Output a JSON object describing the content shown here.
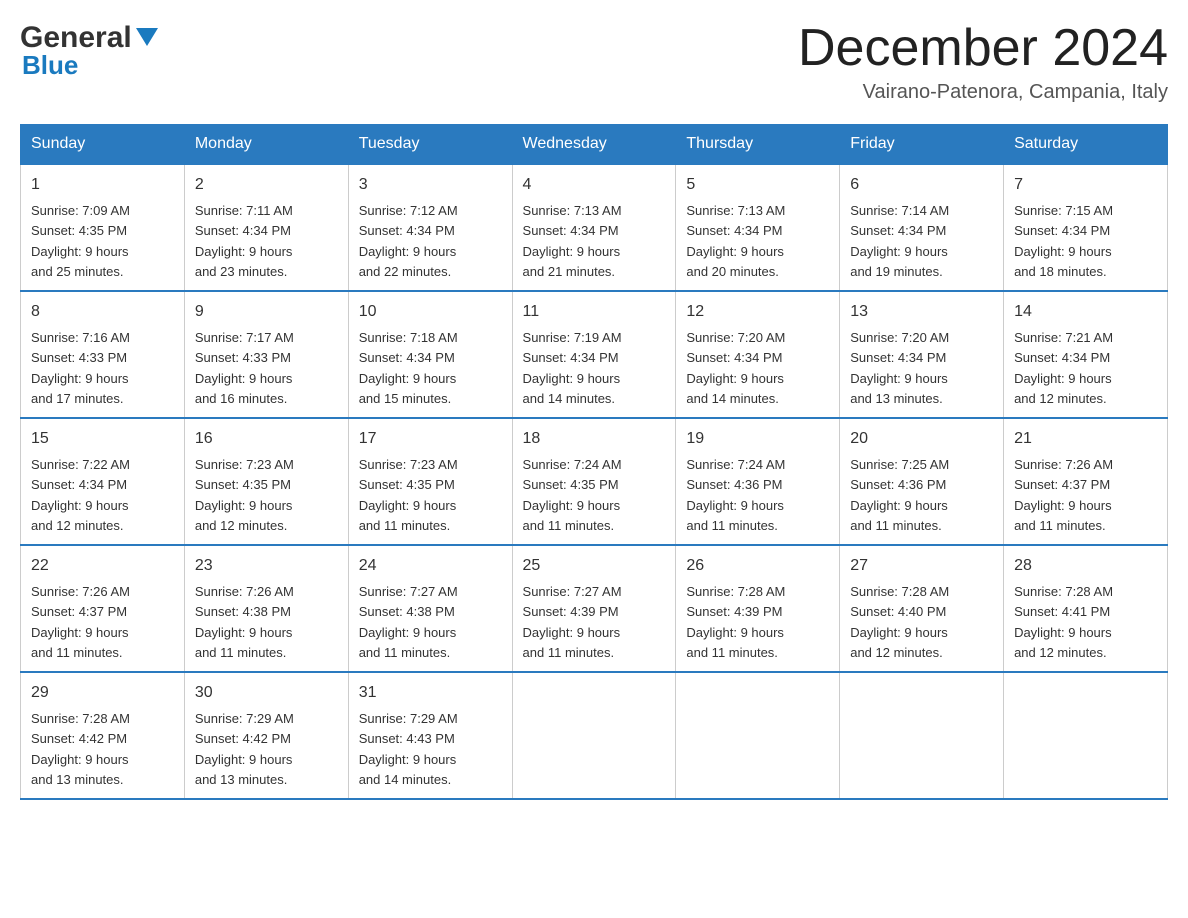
{
  "header": {
    "logo_general": "General",
    "logo_blue": "Blue",
    "month_title": "December 2024",
    "location": "Vairano-Patenora, Campania, Italy"
  },
  "days_of_week": [
    "Sunday",
    "Monday",
    "Tuesday",
    "Wednesday",
    "Thursday",
    "Friday",
    "Saturday"
  ],
  "weeks": [
    [
      {
        "day": "1",
        "sunrise": "7:09 AM",
        "sunset": "4:35 PM",
        "daylight": "9 hours and 25 minutes."
      },
      {
        "day": "2",
        "sunrise": "7:11 AM",
        "sunset": "4:34 PM",
        "daylight": "9 hours and 23 minutes."
      },
      {
        "day": "3",
        "sunrise": "7:12 AM",
        "sunset": "4:34 PM",
        "daylight": "9 hours and 22 minutes."
      },
      {
        "day": "4",
        "sunrise": "7:13 AM",
        "sunset": "4:34 PM",
        "daylight": "9 hours and 21 minutes."
      },
      {
        "day": "5",
        "sunrise": "7:13 AM",
        "sunset": "4:34 PM",
        "daylight": "9 hours and 20 minutes."
      },
      {
        "day": "6",
        "sunrise": "7:14 AM",
        "sunset": "4:34 PM",
        "daylight": "9 hours and 19 minutes."
      },
      {
        "day": "7",
        "sunrise": "7:15 AM",
        "sunset": "4:34 PM",
        "daylight": "9 hours and 18 minutes."
      }
    ],
    [
      {
        "day": "8",
        "sunrise": "7:16 AM",
        "sunset": "4:33 PM",
        "daylight": "9 hours and 17 minutes."
      },
      {
        "day": "9",
        "sunrise": "7:17 AM",
        "sunset": "4:33 PM",
        "daylight": "9 hours and 16 minutes."
      },
      {
        "day": "10",
        "sunrise": "7:18 AM",
        "sunset": "4:34 PM",
        "daylight": "9 hours and 15 minutes."
      },
      {
        "day": "11",
        "sunrise": "7:19 AM",
        "sunset": "4:34 PM",
        "daylight": "9 hours and 14 minutes."
      },
      {
        "day": "12",
        "sunrise": "7:20 AM",
        "sunset": "4:34 PM",
        "daylight": "9 hours and 14 minutes."
      },
      {
        "day": "13",
        "sunrise": "7:20 AM",
        "sunset": "4:34 PM",
        "daylight": "9 hours and 13 minutes."
      },
      {
        "day": "14",
        "sunrise": "7:21 AM",
        "sunset": "4:34 PM",
        "daylight": "9 hours and 12 minutes."
      }
    ],
    [
      {
        "day": "15",
        "sunrise": "7:22 AM",
        "sunset": "4:34 PM",
        "daylight": "9 hours and 12 minutes."
      },
      {
        "day": "16",
        "sunrise": "7:23 AM",
        "sunset": "4:35 PM",
        "daylight": "9 hours and 12 minutes."
      },
      {
        "day": "17",
        "sunrise": "7:23 AM",
        "sunset": "4:35 PM",
        "daylight": "9 hours and 11 minutes."
      },
      {
        "day": "18",
        "sunrise": "7:24 AM",
        "sunset": "4:35 PM",
        "daylight": "9 hours and 11 minutes."
      },
      {
        "day": "19",
        "sunrise": "7:24 AM",
        "sunset": "4:36 PM",
        "daylight": "9 hours and 11 minutes."
      },
      {
        "day": "20",
        "sunrise": "7:25 AM",
        "sunset": "4:36 PM",
        "daylight": "9 hours and 11 minutes."
      },
      {
        "day": "21",
        "sunrise": "7:26 AM",
        "sunset": "4:37 PM",
        "daylight": "9 hours and 11 minutes."
      }
    ],
    [
      {
        "day": "22",
        "sunrise": "7:26 AM",
        "sunset": "4:37 PM",
        "daylight": "9 hours and 11 minutes."
      },
      {
        "day": "23",
        "sunrise": "7:26 AM",
        "sunset": "4:38 PM",
        "daylight": "9 hours and 11 minutes."
      },
      {
        "day": "24",
        "sunrise": "7:27 AM",
        "sunset": "4:38 PM",
        "daylight": "9 hours and 11 minutes."
      },
      {
        "day": "25",
        "sunrise": "7:27 AM",
        "sunset": "4:39 PM",
        "daylight": "9 hours and 11 minutes."
      },
      {
        "day": "26",
        "sunrise": "7:28 AM",
        "sunset": "4:39 PM",
        "daylight": "9 hours and 11 minutes."
      },
      {
        "day": "27",
        "sunrise": "7:28 AM",
        "sunset": "4:40 PM",
        "daylight": "9 hours and 12 minutes."
      },
      {
        "day": "28",
        "sunrise": "7:28 AM",
        "sunset": "4:41 PM",
        "daylight": "9 hours and 12 minutes."
      }
    ],
    [
      {
        "day": "29",
        "sunrise": "7:28 AM",
        "sunset": "4:42 PM",
        "daylight": "9 hours and 13 minutes."
      },
      {
        "day": "30",
        "sunrise": "7:29 AM",
        "sunset": "4:42 PM",
        "daylight": "9 hours and 13 minutes."
      },
      {
        "day": "31",
        "sunrise": "7:29 AM",
        "sunset": "4:43 PM",
        "daylight": "9 hours and 14 minutes."
      },
      null,
      null,
      null,
      null
    ]
  ],
  "labels": {
    "sunrise": "Sunrise:",
    "sunset": "Sunset:",
    "daylight": "Daylight:"
  }
}
